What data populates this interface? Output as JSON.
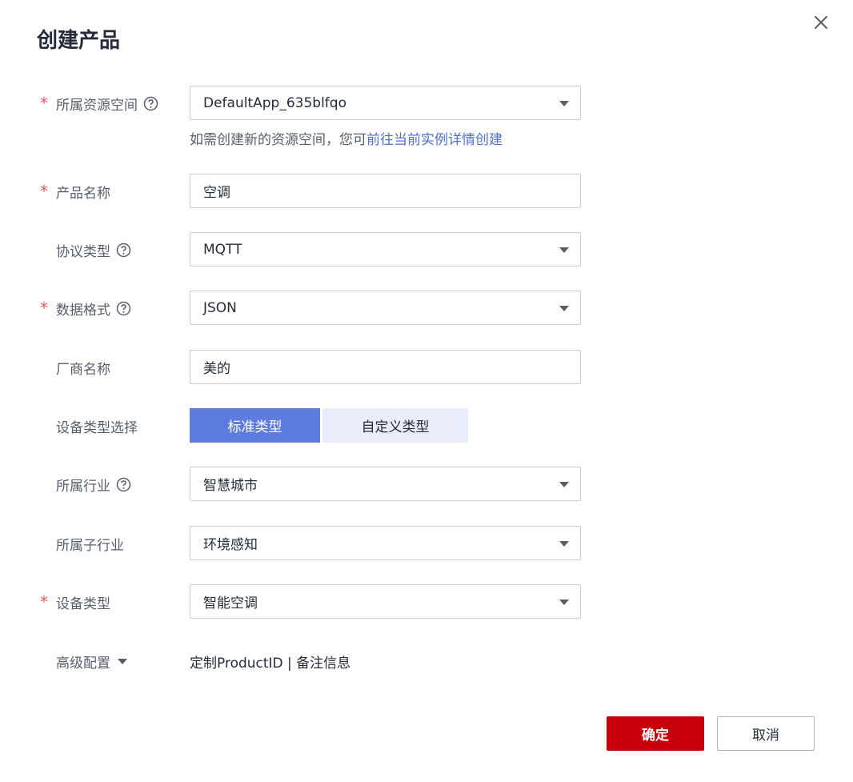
{
  "dialog": {
    "title": "创建产品",
    "close_icon": "close-icon"
  },
  "form": {
    "resource_space": {
      "label": "所属资源空间",
      "required": true,
      "value": "DefaultApp_635blfqo",
      "hint_text": "如需创建新的资源空间，您可",
      "hint_link": "前往当前实例详情创建"
    },
    "product_name": {
      "label": "产品名称",
      "required": true,
      "value": "空调"
    },
    "protocol_type": {
      "label": "协议类型",
      "required": false,
      "value": "MQTT"
    },
    "data_format": {
      "label": "数据格式",
      "required": true,
      "value": "JSON"
    },
    "manufacturer": {
      "label": "厂商名称",
      "required": false,
      "value": "美的"
    },
    "device_type_choice": {
      "label": "设备类型选择",
      "options": [
        "标准类型",
        "自定义类型"
      ],
      "selected": "标准类型"
    },
    "industry": {
      "label": "所属行业",
      "required": false,
      "value": "智慧城市"
    },
    "sub_industry": {
      "label": "所属子行业",
      "required": false,
      "value": "环境感知"
    },
    "device_type": {
      "label": "设备类型",
      "required": true,
      "value": "智能空调"
    },
    "advanced": {
      "label": "高级配置",
      "summary": "定制ProductID | 备注信息"
    }
  },
  "required_marker": "*",
  "footer": {
    "confirm_label": "确定",
    "cancel_label": "取消"
  },
  "colors": {
    "primary": "#c7000b",
    "segment_active": "#5e7ce0",
    "segment_inactive": "#e8ecfb",
    "link": "#526ecc",
    "required": "#e65c5c"
  }
}
